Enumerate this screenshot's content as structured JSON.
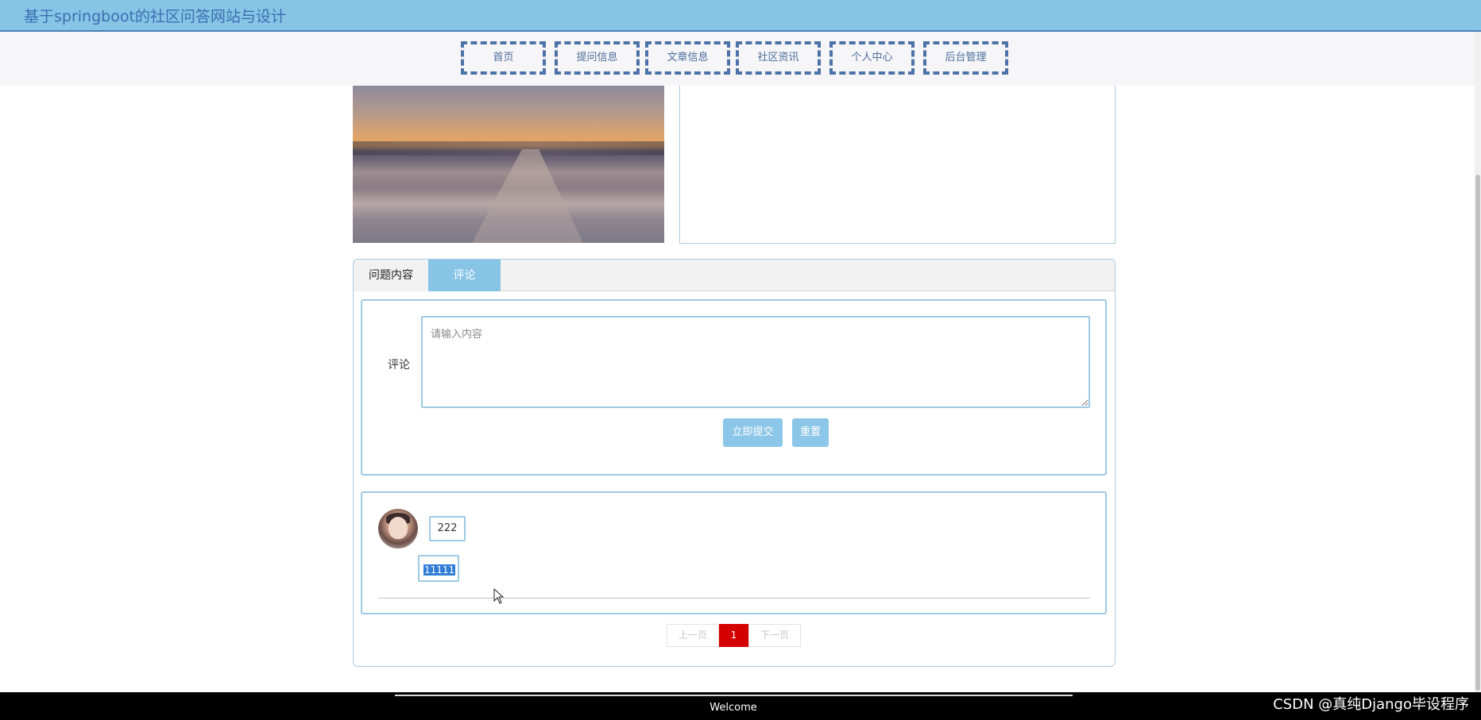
{
  "site": {
    "title": "基于springboot的社区问答网站与设计"
  },
  "nav": {
    "items": [
      {
        "label": "首页"
      },
      {
        "label": "提问信息"
      },
      {
        "label": "文章信息"
      },
      {
        "label": "社区资讯"
      },
      {
        "label": "个人中心"
      },
      {
        "label": "后台管理"
      }
    ]
  },
  "tabs": {
    "question_label": "问题内容",
    "comment_label": "评论"
  },
  "comment_form": {
    "label": "评论",
    "placeholder": "请输入内容",
    "value": "",
    "submit_label": "立即提交",
    "reset_label": "重置"
  },
  "comments": [
    {
      "username": "222",
      "content": "11111"
    }
  ],
  "pagination": {
    "prev_label": "上一页",
    "current_page": "1",
    "next_label": "下一页"
  },
  "footer": {
    "text": "Welcome"
  },
  "watermark": {
    "text": "CSDN @真纯Django毕设程序"
  },
  "colors": {
    "header_bg": "#87c4e6",
    "nav_border": "#4c72a8",
    "active_tab": "#87c4e6",
    "button_bg": "#8cc6e8",
    "page_current_bg": "#d40000",
    "footer_bg": "#000000"
  }
}
